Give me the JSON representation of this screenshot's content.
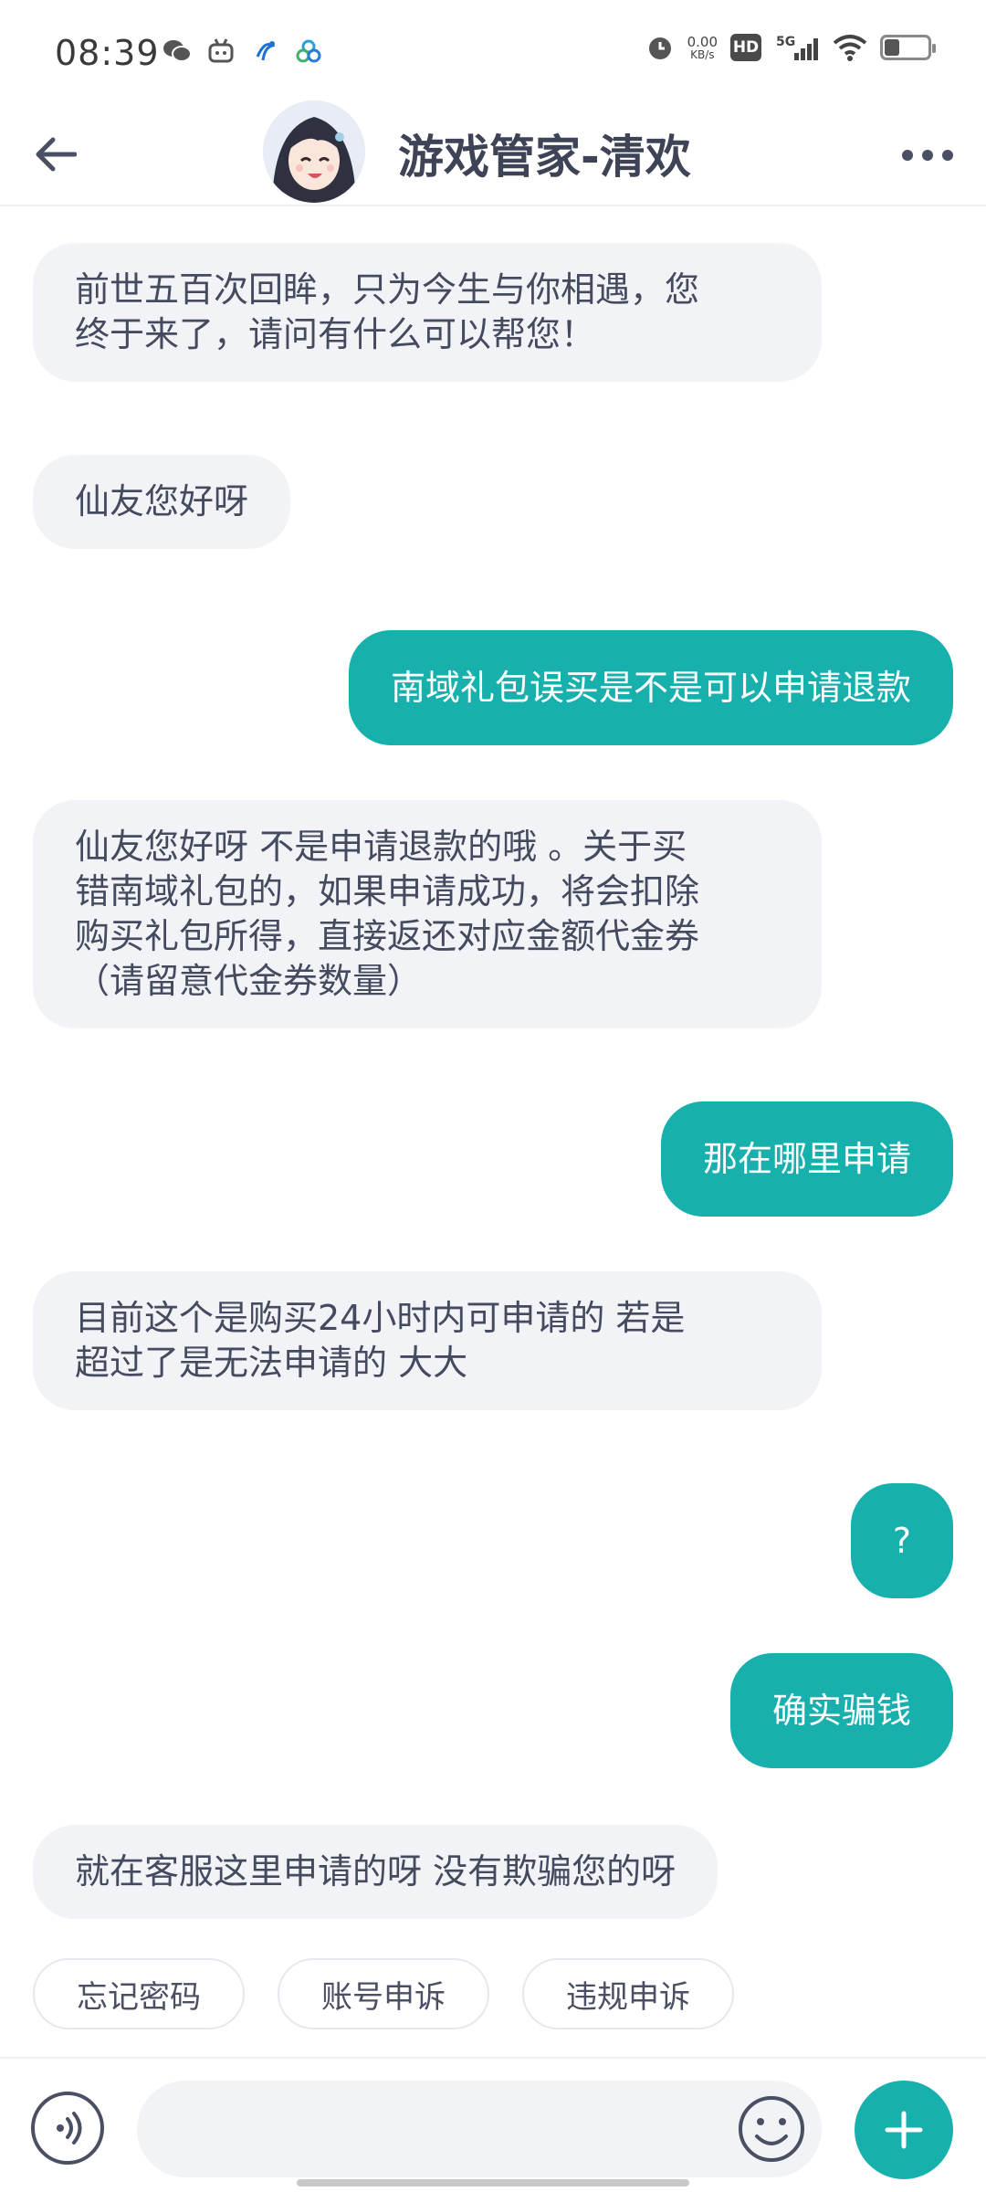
{
  "status_bar": {
    "time": "08:39",
    "net_speed_value": "0.00",
    "net_speed_unit": "KB/s",
    "hd_label": "HD",
    "network_label": "5G",
    "battery_level": 0.35,
    "left_icons": [
      "wechat-icon",
      "bilibili-icon",
      "telecom-icon",
      "cloud-icon"
    ]
  },
  "header": {
    "title": "游戏管家-清欢"
  },
  "messages": [
    {
      "role": "bot",
      "text_lines": [
        "前世五百次回眸，只为今生与你相遇，您",
        "终于来了，请问有什么可以帮您！"
      ]
    },
    {
      "role": "bot",
      "text_lines": [
        "仙友您好呀"
      ]
    },
    {
      "role": "user",
      "text_lines": [
        "南域礼包误买是不是可以申请退款"
      ]
    },
    {
      "role": "bot",
      "text_lines": [
        "仙友您好呀 不是申请退款的哦 。关于买",
        "错南域礼包的，如果申请成功，将会扣除",
        "购买礼包所得，直接返还对应金额代金券",
        "（请留意代金券数量）"
      ]
    },
    {
      "role": "user",
      "text_lines": [
        "那在哪里申请"
      ]
    },
    {
      "role": "bot",
      "text_lines": [
        "目前这个是购买24小时内可申请的 若是",
        "超过了是无法申请的 大大"
      ]
    },
    {
      "role": "user",
      "text_lines": [
        "?"
      ]
    },
    {
      "role": "user",
      "text_lines": [
        "确实骗钱"
      ]
    },
    {
      "role": "bot",
      "text_lines": [
        "就在客服这里申请的呀 没有欺骗您的呀"
      ]
    }
  ],
  "quick_replies": [
    "忘记密码",
    "账号申诉",
    "违规申诉"
  ],
  "composer": {
    "input_value": "",
    "placeholder": ""
  },
  "colors": {
    "accent": "#17b0ad",
    "bot_bubble": "#f1f3f7",
    "text_dark": "#454a5e"
  }
}
